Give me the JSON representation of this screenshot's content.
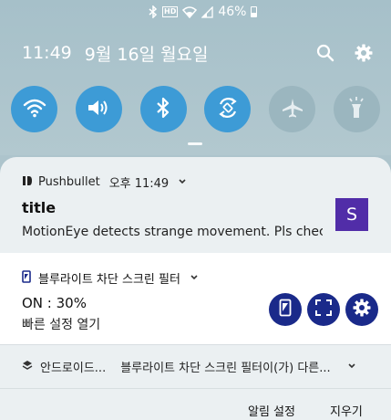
{
  "status_bar": {
    "icons": [
      "bluetooth-icon",
      "hd-icon",
      "wifi-icon",
      "signal-icon"
    ],
    "hd_label": "HD",
    "battery": "46%"
  },
  "header": {
    "time": "11:49",
    "date": "9월 16일 월요일",
    "actions": [
      "search-icon",
      "settings-gear-icon"
    ]
  },
  "quick_toggles": [
    {
      "icon": "wifi-icon",
      "state": "on"
    },
    {
      "icon": "sound-icon",
      "state": "on"
    },
    {
      "icon": "bluetooth-icon",
      "state": "on"
    },
    {
      "icon": "auto-rotate-icon",
      "state": "on"
    },
    {
      "icon": "airplane-mode-icon",
      "state": "off"
    },
    {
      "icon": "flashlight-icon",
      "state": "off"
    }
  ],
  "notifications": {
    "pushbullet": {
      "app": "Pushbullet",
      "time": "오후 11:49",
      "title": "title",
      "body": "MotionEye detects strange movement. Pls chec..",
      "avatar_letter": "S",
      "avatar_color": "#512da8"
    },
    "blue_light": {
      "app": "블루라이트 차단 스크린 필터",
      "status": "ON : 30%",
      "sub": "빠른 설정 열기",
      "actions": [
        "screen-filter-icon",
        "fullscreen-icon",
        "settings-gear-icon"
      ],
      "action_color": "#1a2a8a"
    },
    "android_system": {
      "app": "안드로이드...",
      "text": "블루라이트 차단 스크린 필터이(가) 다른..."
    }
  },
  "footer": {
    "notification_settings": "알림 설정",
    "clear": "지우기"
  },
  "colors": {
    "toggle_on": "#3d9bd6",
    "toggle_off": "#9bb6bf",
    "shade": "#adc4cc",
    "card": "#ebf0f2"
  }
}
